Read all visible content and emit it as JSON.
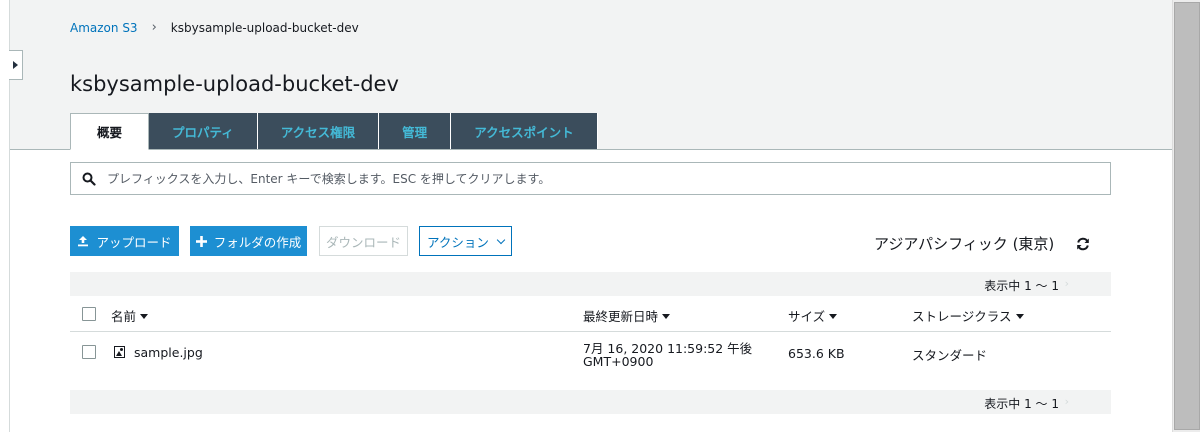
{
  "breadcrumb": {
    "root": "Amazon S3",
    "separator": "›",
    "current": "ksbysample-upload-bucket-dev"
  },
  "page_title": "ksbysample-upload-bucket-dev",
  "tabs": [
    {
      "label": "概要",
      "active": true
    },
    {
      "label": "プロパティ",
      "active": false
    },
    {
      "label": "アクセス権限",
      "active": false
    },
    {
      "label": "管理",
      "active": false
    },
    {
      "label": "アクセスポイント",
      "active": false
    }
  ],
  "search": {
    "placeholder": "プレフィックスを入力し、Enter キーで検索します。ESC を押してクリアします。",
    "value": "",
    "icon": "search-icon"
  },
  "toolbar": {
    "upload_label": "アップロード",
    "create_folder_label": "フォルダの作成",
    "download_label": "ダウンロード",
    "actions_label": "アクション"
  },
  "region": "アジアパシフィック (東京)",
  "pager": {
    "label": "表示中 1 ～ 1"
  },
  "table": {
    "columns": {
      "name": "名前",
      "modified": "最終更新日時",
      "size": "サイズ",
      "storage_class": "ストレージクラス"
    },
    "rows": [
      {
        "name": "sample.jpg",
        "modified_line1": "7月 16, 2020 11:59:52 午後",
        "modified_line2": "GMT+0900",
        "size": "653.6 KB",
        "storage_class": "スタンダード"
      }
    ]
  },
  "colors": {
    "primary": "#1d8fd2",
    "link": "#0073bb",
    "tab_bg": "#3b4d5c",
    "tab_text": "#44b9d6"
  }
}
